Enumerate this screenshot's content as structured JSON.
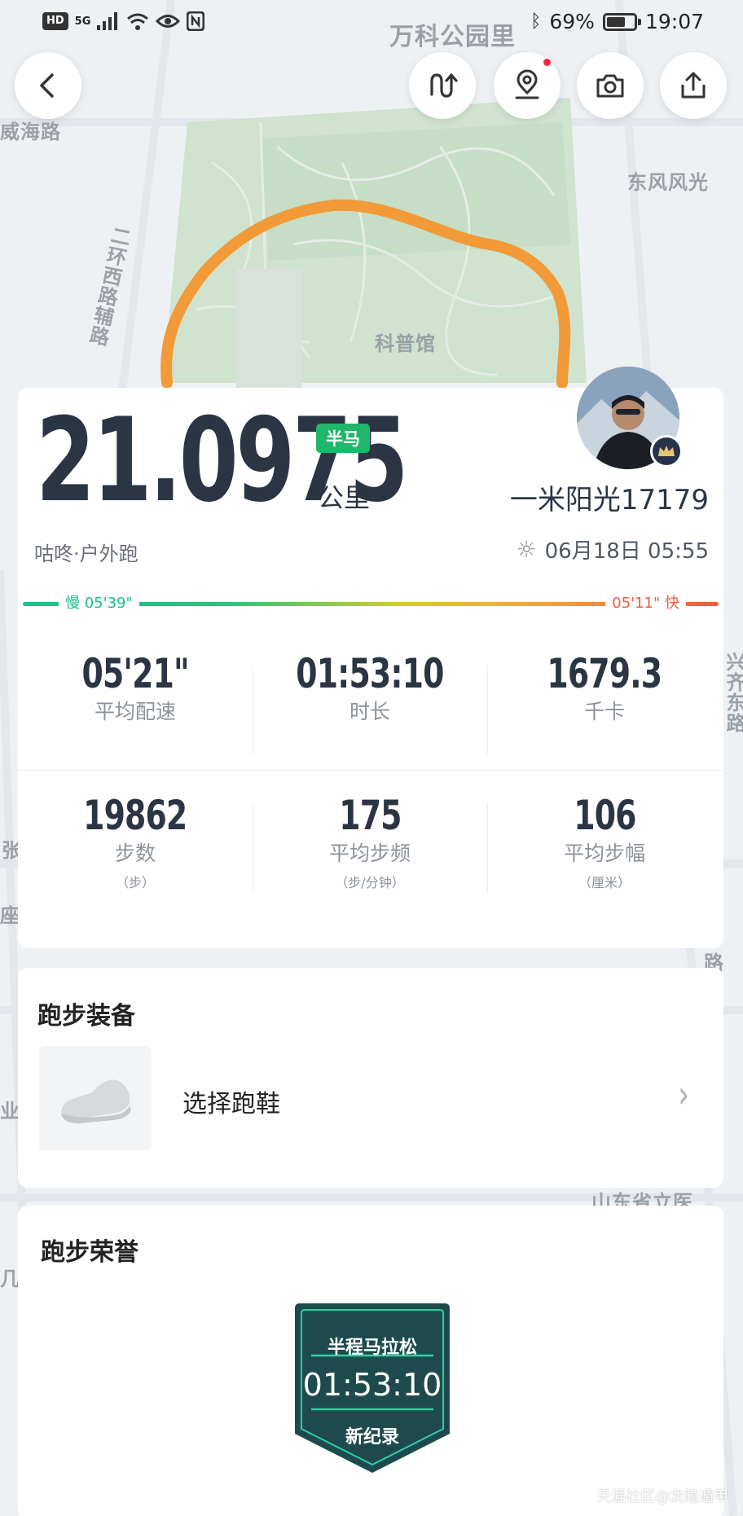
{
  "status_bar": {
    "hd": "HD",
    "signal": "5G",
    "battery_percent": "69%",
    "battery_level": 0.69,
    "time": "19:07"
  },
  "map": {
    "labels": {
      "wanke": "万科公园里",
      "weihai": "威海路",
      "dongfeng": "东风风光",
      "erhuan": "二环西路辅路",
      "kepu": "科普馆",
      "xingqi": "兴齐东路",
      "shandong": "山东省立医",
      "zhang": "张",
      "zuo": "座",
      "lu": "路",
      "ye": "业",
      "ji": "几"
    },
    "route_color": "#f29a38"
  },
  "toolbar": {
    "back_icon": "chevron-left-icon",
    "route_icon": "route-arrows-icon",
    "location_icon": "location-pin-icon",
    "camera_icon": "camera-icon",
    "share_icon": "share-icon"
  },
  "summary": {
    "distance": "21.0975",
    "badge": "半马",
    "unit": "公里",
    "username": "一米阳光17179",
    "sport_type": "咕咚·户外跑",
    "datetime": "06月18日 05:55",
    "pace_slow": "慢 05'39\"",
    "pace_fast": "05'11\" 快",
    "colors": {
      "accent_green": "#20b66c",
      "slow": "#1bbf85",
      "fast": "#ef5a3e"
    }
  },
  "stats": [
    {
      "value": "05'21\"",
      "label": "平均配速",
      "sub": ""
    },
    {
      "value": "01:53:10",
      "label": "时长",
      "sub": ""
    },
    {
      "value": "1679.3",
      "label": "千卡",
      "sub": ""
    },
    {
      "value": "19862",
      "label": "步数",
      "sub": "（步）"
    },
    {
      "value": "175",
      "label": "平均步频",
      "sub": "（步/分钟）"
    },
    {
      "value": "106",
      "label": "平均步幅",
      "sub": "（厘米）"
    }
  ],
  "gear": {
    "title": "跑步装备",
    "select_label": "选择跑鞋",
    "shoe_icon": "running-shoe-icon",
    "chevron": "›"
  },
  "honor": {
    "title": "跑步荣誉",
    "medal_title": "半程马拉松",
    "medal_time": "01:53:10",
    "medal_note": "新纪录"
  },
  "watermark": "天涯社区@龙隐遁甲"
}
